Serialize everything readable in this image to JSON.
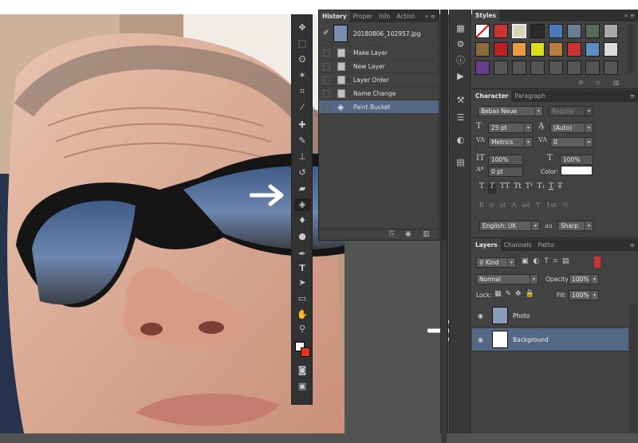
{
  "history": {
    "tabs": [
      "History",
      "Proper",
      "Info",
      "Action"
    ],
    "snapshot": "20180806_102957.jpg",
    "steps": [
      {
        "label": "Make Layer",
        "selected": false
      },
      {
        "label": "New Layer",
        "selected": false
      },
      {
        "label": "Layer Order",
        "selected": false
      },
      {
        "label": "Name Change",
        "selected": false
      },
      {
        "label": "Paint Bucket",
        "selected": true
      }
    ]
  },
  "styles": {
    "tab": "Styles"
  },
  "character": {
    "tabs": [
      "Character",
      "Paragraph"
    ],
    "font_family": "Bebas Neue",
    "font_style": "Regular",
    "font_size": "25 pt",
    "leading": "(Auto)",
    "kerning": "Metrics",
    "tracking": "0",
    "vertical_scale": "100%",
    "horizontal_scale": "100%",
    "baseline_shift": "0 pt",
    "color_label": "Color:",
    "language": "English: UK",
    "antialias_icon": "aɑ",
    "antialias": "Sharp",
    "type_buttons": [
      "T",
      "T",
      "TT",
      "Tt",
      "T¹",
      "T₁",
      "T",
      "T̶"
    ],
    "opentype_buttons": [
      "fi",
      "σ",
      "st",
      "Α",
      "ad",
      "T",
      "1st",
      "½"
    ]
  },
  "layers": {
    "tabs": [
      "Layers",
      "Channels",
      "Paths"
    ],
    "filter": "Kind",
    "blend_mode": "Normal",
    "opacity_label": "Opacity:",
    "opacity": "100%",
    "lock_label": "Lock:",
    "fill_label": "Fill:",
    "fill": "100%",
    "items": [
      {
        "name": "Photo",
        "selected": false
      },
      {
        "name": "Background",
        "selected": true
      }
    ]
  },
  "colors": {
    "selection": "#536885",
    "panel": "#424242",
    "foreground": "#ffffff",
    "background_swatch": "#e5331e"
  }
}
